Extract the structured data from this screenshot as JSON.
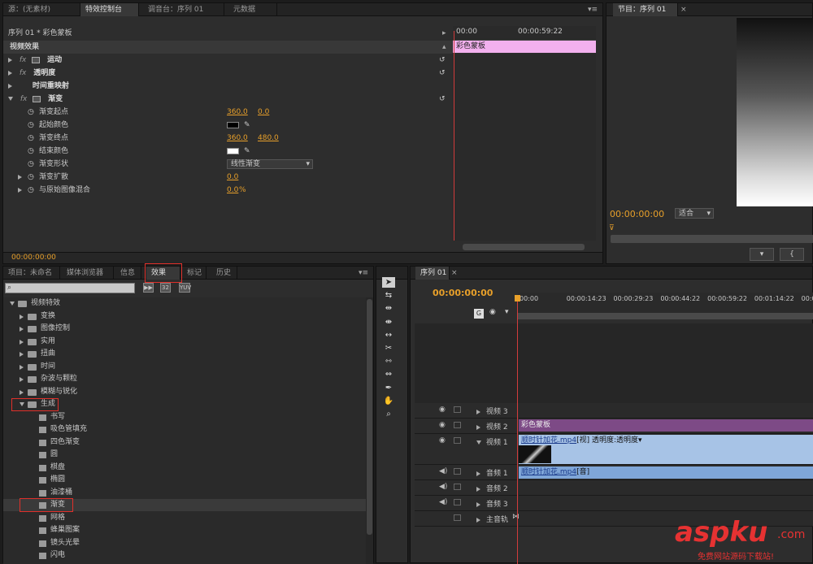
{
  "source_panel": {
    "tabs": [
      "源：(无素材)",
      "特效控制台",
      "调音台：序列 01",
      "元数据"
    ],
    "active_tab": 1
  },
  "program_panel": {
    "tab": "节目：序列 01",
    "timecode": "00:00:00:00",
    "zoom": "适合"
  },
  "effect_controls": {
    "sequence_title": "序列 01 * 彩色蒙板",
    "ruler_start": "00:00",
    "ruler_end": "00:00:59:22",
    "clip_label": "彩色蒙板",
    "section_header": "视频效果",
    "effects": [
      {
        "name": "运动",
        "fx": "fx",
        "has_box": true
      },
      {
        "name": "透明度",
        "fx": "fx",
        "has_box": false
      },
      {
        "name": "时间重映射",
        "fx": "",
        "has_box": false
      },
      {
        "name": "渐变",
        "fx": "fx",
        "has_box": true
      }
    ],
    "params": [
      {
        "name": "渐变起点",
        "v1": "360.0",
        "v2": "0.0",
        "kind": "pair"
      },
      {
        "name": "起始颜色",
        "color": "#000000",
        "kind": "color"
      },
      {
        "name": "渐变终点",
        "v1": "360.0",
        "v2": "480.0",
        "kind": "pair"
      },
      {
        "name": "结束颜色",
        "color": "#ffffff",
        "kind": "color"
      },
      {
        "name": "渐变形状",
        "select": "线性渐变",
        "kind": "select"
      },
      {
        "name": "渐变扩散",
        "v1": "0.0",
        "kind": "single",
        "arrow": true
      },
      {
        "name": "与原始图像混合",
        "v1": "0.0",
        "unit": "%",
        "kind": "single",
        "arrow": true
      }
    ],
    "timecode": "00:00:00:00"
  },
  "project_panel": {
    "tabs": [
      "项目：未命名",
      "媒体浏览器",
      "信息",
      "效果",
      "标记",
      "历史"
    ],
    "active_tab": 3,
    "tree": [
      {
        "label": "视频特效",
        "level": 0,
        "type": "folder",
        "open": true
      },
      {
        "label": "变换",
        "level": 1,
        "type": "folder"
      },
      {
        "label": "图像控制",
        "level": 1,
        "type": "folder"
      },
      {
        "label": "实用",
        "level": 1,
        "type": "folder"
      },
      {
        "label": "扭曲",
        "level": 1,
        "type": "folder"
      },
      {
        "label": "时间",
        "level": 1,
        "type": "folder"
      },
      {
        "label": "杂波与颗粒",
        "level": 1,
        "type": "folder"
      },
      {
        "label": "模糊与锐化",
        "level": 1,
        "type": "folder"
      },
      {
        "label": "生成",
        "level": 1,
        "type": "folder",
        "open": true
      },
      {
        "label": "书写",
        "level": 2,
        "type": "effect"
      },
      {
        "label": "吸色管填充",
        "level": 2,
        "type": "effect"
      },
      {
        "label": "四色渐变",
        "level": 2,
        "type": "effect"
      },
      {
        "label": "圆",
        "level": 2,
        "type": "effect"
      },
      {
        "label": "棋盘",
        "level": 2,
        "type": "effect"
      },
      {
        "label": "椭圆",
        "level": 2,
        "type": "effect"
      },
      {
        "label": "油漆桶",
        "level": 2,
        "type": "effect"
      },
      {
        "label": "渐变",
        "level": 2,
        "type": "effect",
        "selected": true
      },
      {
        "label": "网格",
        "level": 2,
        "type": "effect"
      },
      {
        "label": "蜂巢图案",
        "level": 2,
        "type": "effect"
      },
      {
        "label": "镜头光晕",
        "level": 2,
        "type": "effect"
      },
      {
        "label": "闪电",
        "level": 2,
        "type": "effect"
      }
    ]
  },
  "tools": [
    "selection-tool",
    "track-select-tool",
    "ripple-edit-tool",
    "rolling-edit-tool",
    "rate-stretch-tool",
    "razor-tool",
    "slip-tool",
    "slide-tool",
    "pen-tool",
    "hand-tool",
    "zoom-tool"
  ],
  "timeline": {
    "tab": "序列 01",
    "timecode": "00:00:00:00",
    "ruler": [
      "00:00",
      "00:00:14:23",
      "00:00:29:23",
      "00:00:44:22",
      "00:00:59:22",
      "00:01:14:22",
      "00:01:29:"
    ],
    "video_tracks": [
      "视频 3",
      "视频 2",
      "视频 1"
    ],
    "audio_tracks": [
      "音频 1",
      "音频 2",
      "音频 3"
    ],
    "master": "主音轨",
    "clip_v2": "彩色蒙板",
    "clip_v1": {
      "name": "顺时针加花.mp4",
      "tag": "[视]",
      "opacity": "透明度:透明度"
    },
    "clip_a1": {
      "name": "顺时针加花.mp4",
      "tag": "[音]"
    }
  },
  "watermark": {
    "text": "aspku",
    "suffix": ".com",
    "sub": "免费网站源码下载站!"
  }
}
